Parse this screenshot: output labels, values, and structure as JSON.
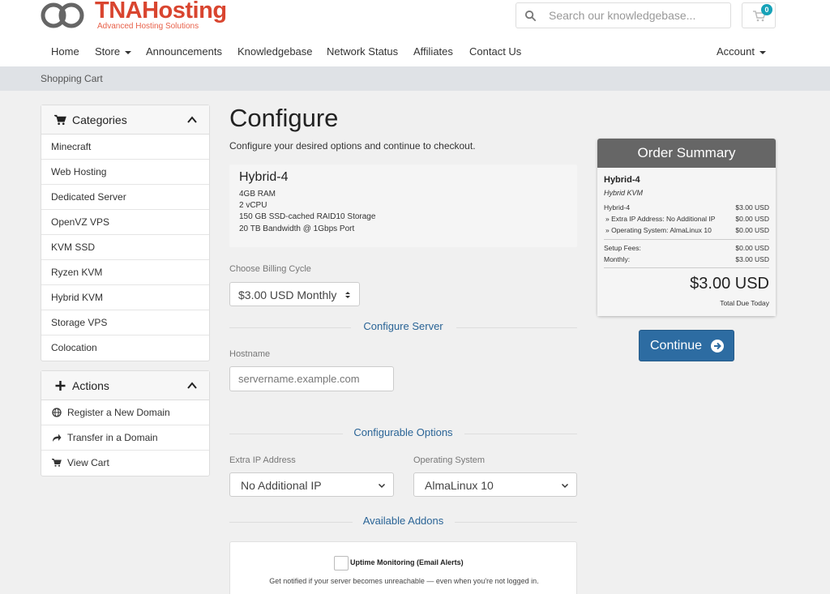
{
  "brand": {
    "name": "TNAHosting",
    "tagline": "Advanced Hosting Solutions",
    "color": "#d9452f"
  },
  "search": {
    "placeholder": "Search our knowledgebase..."
  },
  "cart": {
    "count": "0"
  },
  "nav": {
    "items": [
      {
        "label": "Home"
      },
      {
        "label": "Store"
      },
      {
        "label": "Announcements"
      },
      {
        "label": "Knowledgebase"
      },
      {
        "label": "Network Status"
      },
      {
        "label": "Affiliates"
      },
      {
        "label": "Contact Us"
      }
    ],
    "account": "Account"
  },
  "breadcrumb": "Shopping Cart",
  "sidebar": {
    "categories": {
      "title": "Categories",
      "items": [
        "Minecraft",
        "Web Hosting",
        "Dedicated Server",
        "OpenVZ VPS",
        "KVM SSD",
        "Ryzen KVM",
        "Hybrid KVM",
        "Storage VPS",
        "Colocation"
      ]
    },
    "actions": {
      "title": "Actions",
      "items": [
        {
          "label": "Register a New Domain",
          "icon": "globe-icon"
        },
        {
          "label": "Transfer in a Domain",
          "icon": "share-icon"
        },
        {
          "label": "View Cart",
          "icon": "cart-icon"
        }
      ]
    }
  },
  "main": {
    "title": "Configure",
    "description": "Configure your desired options and continue to checkout.",
    "product": {
      "name": "Hybrid-4",
      "specs": [
        "4GB RAM",
        "2 vCPU",
        "150 GB SSD-cached RAID10 Storage",
        "20 TB Bandwidth @ 1Gbps Port"
      ]
    },
    "billing": {
      "label": "Choose Billing Cycle",
      "value": "$3.00 USD Monthly"
    },
    "configure_server": {
      "heading": "Configure Server",
      "hostname_label": "Hostname",
      "hostname_placeholder": "servername.example.com"
    },
    "configurable_options": {
      "heading": "Configurable Options",
      "extra_ip": {
        "label": "Extra IP Address",
        "value": "No Additional IP"
      },
      "os": {
        "label": "Operating System",
        "value": "AlmaLinux 10"
      }
    },
    "addons": {
      "heading": "Available Addons",
      "item": {
        "title": "Uptime Monitoring (Email Alerts)",
        "description": "Get notified if your server becomes unreachable — even when you're not logged in."
      }
    }
  },
  "summary": {
    "title": "Order Summary",
    "product_name": "Hybrid-4",
    "product_group": "Hybrid KVM",
    "lines": [
      {
        "label": "Hybrid-4",
        "value": "$3.00 USD"
      },
      {
        "label": "» Extra IP Address: No Additional IP",
        "value": "$0.00 USD"
      },
      {
        "label": "» Operating System: AlmaLinux 10",
        "value": "$0.00 USD"
      }
    ],
    "fees": [
      {
        "label": "Setup Fees:",
        "value": "$0.00 USD"
      },
      {
        "label": "Monthly:",
        "value": "$3.00 USD"
      }
    ],
    "total": "$3.00 USD",
    "total_label": "Total Due Today"
  },
  "continue": {
    "label": "Continue",
    "color": "#2d6ca2"
  }
}
